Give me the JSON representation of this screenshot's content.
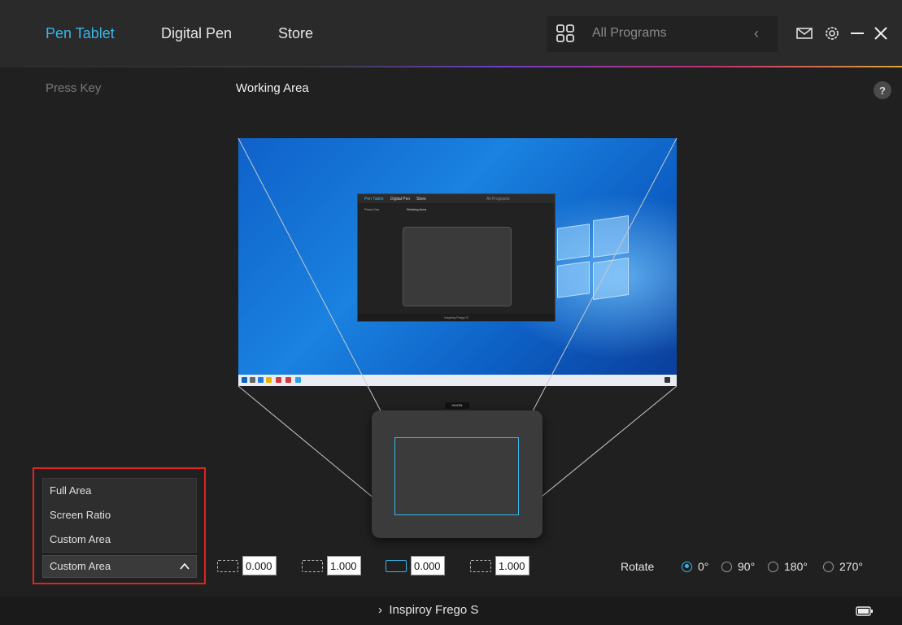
{
  "header": {
    "tabs": [
      {
        "label": "Pen Tablet",
        "active": true
      },
      {
        "label": "Digital Pen",
        "active": false
      },
      {
        "label": "Store",
        "active": false
      }
    ],
    "search": {
      "placeholder": "All Programs",
      "icon": "grid-icon",
      "back_icon": "chevron-left-icon"
    },
    "icons": [
      "mail-icon",
      "gear-icon",
      "minimize-icon",
      "close-icon"
    ],
    "accent_color": "#38b6e8"
  },
  "subtabs": {
    "press_key": "Press Key",
    "working_area": "Working Area",
    "help": "?"
  },
  "preview": {
    "mini_app": {
      "tabs": [
        "Pen Tablet",
        "Digital Pen",
        "Store"
      ],
      "search": "All Programs",
      "press_key": "Press Key",
      "working_area": "Working Area",
      "device": "Inspiroy Frego S"
    },
    "tablet_brand": "HUION"
  },
  "area_menu": {
    "options": [
      "Full Area",
      "Screen Ratio",
      "Custom Area"
    ],
    "selected": "Custom Area",
    "highlight_color": "#e02424"
  },
  "coords": [
    {
      "value": "0.000",
      "icon": "area-left-icon"
    },
    {
      "value": "1.000",
      "icon": "area-width-icon"
    },
    {
      "value": "0.000",
      "icon": "area-top-icon"
    },
    {
      "value": "1.000",
      "icon": "area-height-icon"
    }
  ],
  "rotate": {
    "label": "Rotate",
    "options": [
      "0°",
      "90°",
      "180°",
      "270°"
    ],
    "selected": "0°"
  },
  "footer": {
    "device": "Inspiroy Frego S",
    "chevron": "›",
    "battery_icon": "battery-icon"
  }
}
